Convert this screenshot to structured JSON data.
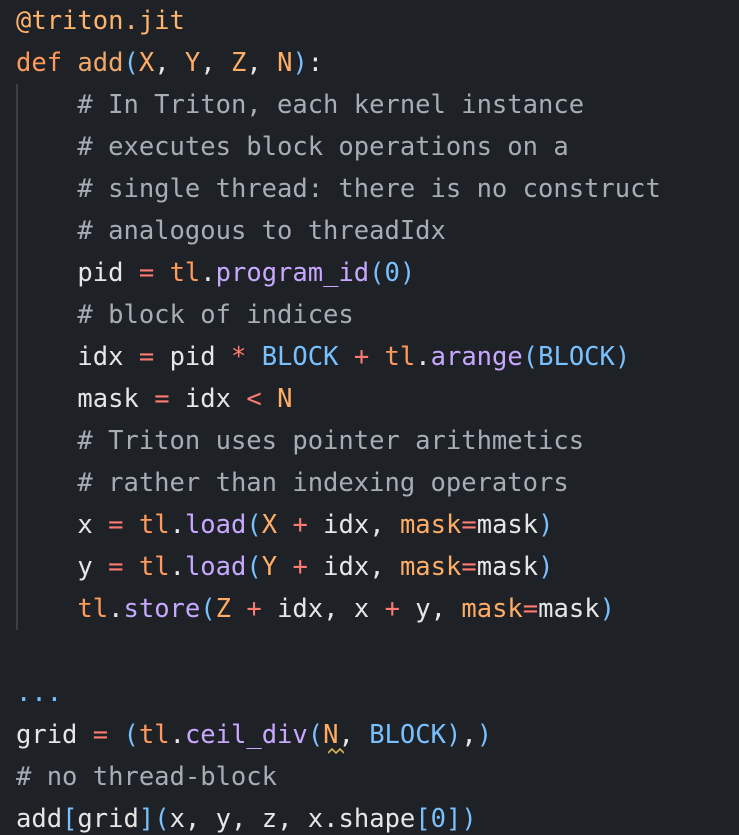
{
  "code_lines": [
    {
      "text": "@triton.jit"
    },
    {
      "text": "def add(X, Y, Z, N):"
    },
    {
      "text": "    # In Triton, each kernel instance"
    },
    {
      "text": "    # executes block operations on a"
    },
    {
      "text": "    # single thread: there is no construct"
    },
    {
      "text": "    # analogous to threadIdx"
    },
    {
      "text": "    pid = tl.program_id(0)"
    },
    {
      "text": "    # block of indices"
    },
    {
      "text": "    idx = pid * BLOCK + tl.arange(BLOCK)"
    },
    {
      "text": "    mask = idx < N"
    },
    {
      "text": "    # Triton uses pointer arithmetics"
    },
    {
      "text": "    # rather than indexing operators"
    },
    {
      "text": "    x = tl.load(X + idx, mask=mask)"
    },
    {
      "text": "    y = tl.load(Y + idx, mask=mask)"
    },
    {
      "text": "    tl.store(Z + idx, x + y, mask=mask)"
    },
    {
      "text": ""
    },
    {
      "text": "..."
    },
    {
      "text": "grid = (tl.ceil_div(N, BLOCK),)"
    },
    {
      "text": "# no thread-block"
    },
    {
      "text": "add[grid](x, y, z, x.shape[0])"
    }
  ],
  "colors": {
    "background": "#1e2227",
    "keyword": "#ff9a5a",
    "comment": "#a7adb6",
    "operator": "#ff7b72",
    "constant": "#79c0ff",
    "method": "#c8a8ff",
    "identifier": "#e6e6e6"
  }
}
